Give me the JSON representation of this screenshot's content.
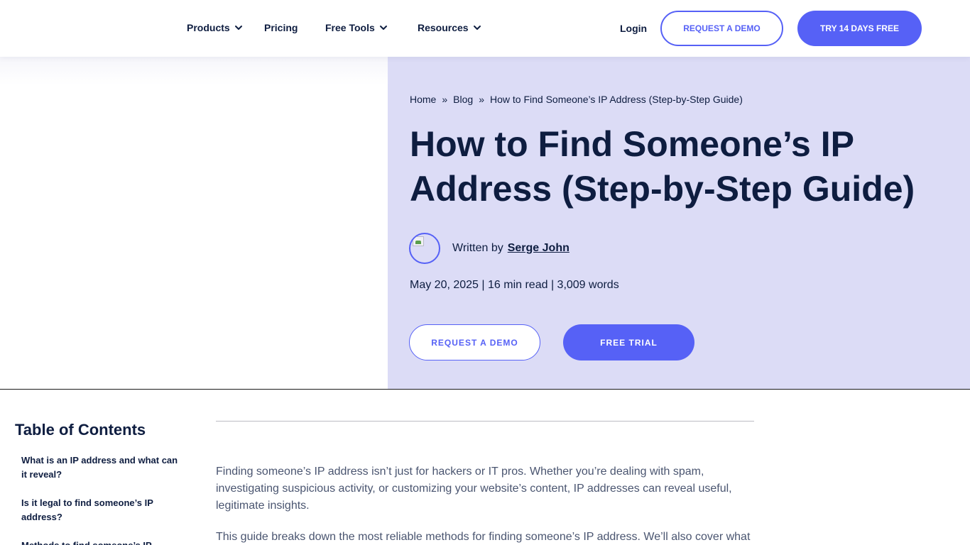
{
  "header": {
    "nav": [
      {
        "label": "Products",
        "has_dropdown": true,
        "icon": "chevron-down-icon"
      },
      {
        "label": "Pricing",
        "has_dropdown": false
      },
      {
        "label": "Free Tools",
        "has_dropdown": true,
        "icon": "chevron-down-icon"
      },
      {
        "label": "Resources",
        "has_dropdown": true,
        "icon": "chevron-down-icon"
      }
    ],
    "login_label": "Login",
    "request_demo_label": "REQUEST A DEMO",
    "trial_label": "TRY 14 DAYS FREE"
  },
  "hero": {
    "breadcrumb": {
      "home": "Home",
      "sep": "»",
      "blog": "Blog",
      "current": "How to Find Someone’s IP Address (Step-by-Step Guide)"
    },
    "title": "How to Find Someone’s IP Address (Step-by-Step Guide)",
    "author": {
      "written_by": "Written by",
      "name": "Serge John"
    },
    "meta": "May 20, 2025 | 16 min read | 3,009 words",
    "request_demo_label": "REQUEST A DEMO",
    "free_trial_label": "FREE TRIAL"
  },
  "toc": {
    "title": "Table of Contents",
    "items": [
      "What is an IP address and what can it reveal?",
      "Is it legal to find someone’s IP address?",
      "Methods to find someone’s IP"
    ]
  },
  "article": {
    "paragraphs": [
      "Finding someone’s IP address isn’t just for hackers or IT pros. Whether you’re dealing with spam, investigating suspicious activity, or customizing your website’s content, IP addresses can reveal useful, legitimate insights.",
      "This guide breaks down the most reliable methods for finding someone’s IP address. We’ll also cover what"
    ]
  },
  "colors": {
    "accent": "#5661f6",
    "hero_bg": "#dcdcf6",
    "heading": "#0e1d40",
    "body_text": "#4a5570"
  }
}
